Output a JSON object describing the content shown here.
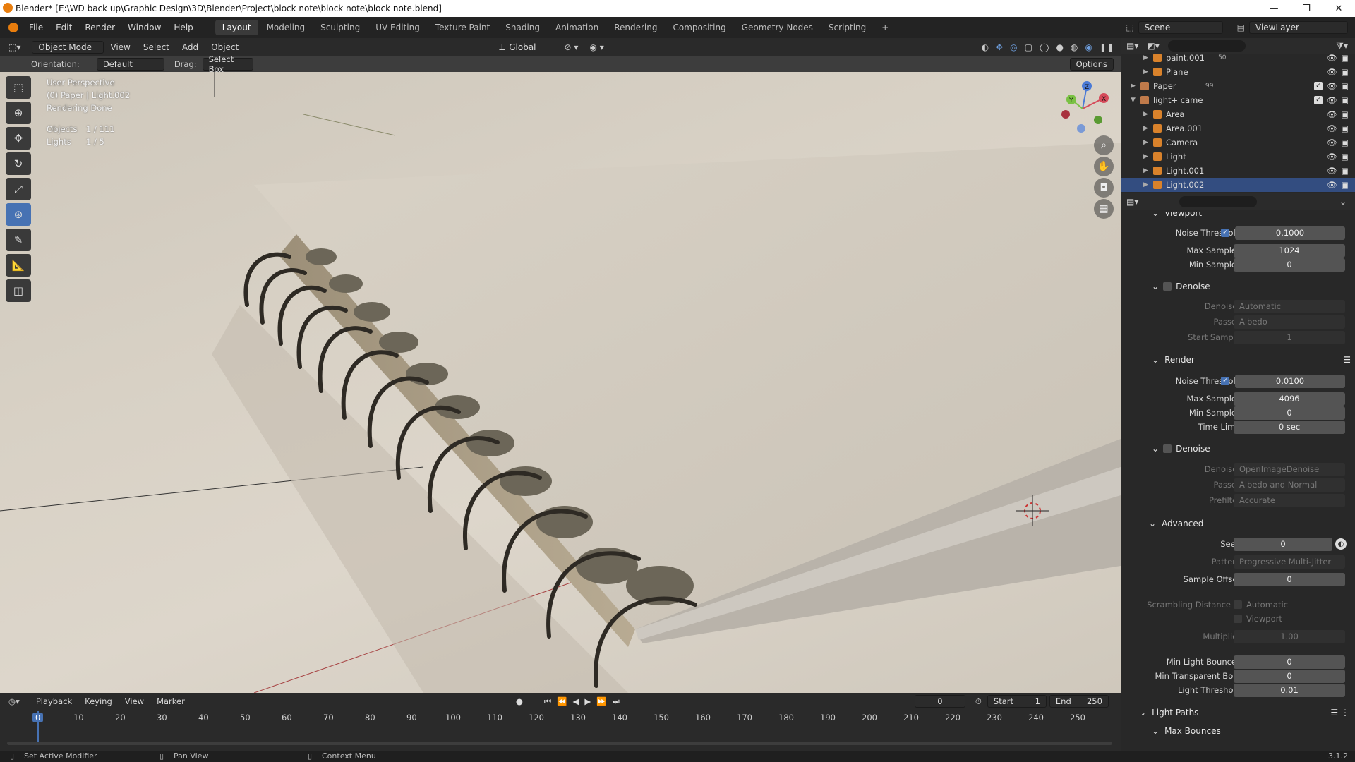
{
  "window": {
    "title": "Blender* [E:\\WD back up\\Graphic Design\\3D\\Blender\\Project\\block note\\block note\\block note.blend]",
    "min": "—",
    "max": "❐",
    "close": "✕"
  },
  "menu": [
    "File",
    "Edit",
    "Render",
    "Window",
    "Help"
  ],
  "workspaces": [
    "Layout",
    "Modeling",
    "Sculpting",
    "UV Editing",
    "Texture Paint",
    "Shading",
    "Animation",
    "Rendering",
    "Compositing",
    "Geometry Nodes",
    "Scripting",
    "+"
  ],
  "active_workspace": "Layout",
  "scene": {
    "label": "Scene",
    "viewlayer": "ViewLayer"
  },
  "header3d": {
    "mode": "Object Mode",
    "menus": [
      "View",
      "Select",
      "Add",
      "Object"
    ],
    "transform": "Global"
  },
  "toolsettings": {
    "orientation_label": "Orientation:",
    "orientation": "Default",
    "drag_label": "Drag:",
    "drag": "Select Box",
    "options": "Options"
  },
  "overlay": {
    "perspective": "User Perspective",
    "object": "(0) Paper | Light.002",
    "status": "Rendering Done",
    "objects_label": "Objects",
    "objects_value": "1 / 111",
    "lights_label": "Lights",
    "lights_value": "1 / 5"
  },
  "gizmo": {
    "x": "X",
    "y": "Y",
    "z": "Z"
  },
  "outliner": [
    {
      "name": "paint.001",
      "sub": "50",
      "indent": 2,
      "sel": false,
      "check": false
    },
    {
      "name": "Plane",
      "sub": "",
      "indent": 2,
      "sel": false,
      "check": false
    },
    {
      "name": "Paper",
      "sub": "99",
      "indent": 1,
      "sel": false,
      "check": true
    },
    {
      "name": "light+ came",
      "sub": "",
      "indent": 1,
      "sel": false,
      "check": true
    },
    {
      "name": "Area",
      "sub": "",
      "indent": 2,
      "sel": false,
      "check": false
    },
    {
      "name": "Area.001",
      "sub": "",
      "indent": 2,
      "sel": false,
      "check": false
    },
    {
      "name": "Camera",
      "sub": "",
      "indent": 2,
      "sel": false,
      "check": false
    },
    {
      "name": "Light",
      "sub": "",
      "indent": 2,
      "sel": false,
      "check": false
    },
    {
      "name": "Light.001",
      "sub": "",
      "indent": 2,
      "sel": false,
      "check": false
    },
    {
      "name": "Light.002",
      "sub": "",
      "indent": 2,
      "sel": true,
      "check": false
    }
  ],
  "props": {
    "viewport": {
      "title": "Viewport",
      "noise_threshold_label": "Noise Threshold",
      "noise_threshold": "0.1000",
      "max_samples_label": "Max Samples",
      "max_samples": "1024",
      "min_samples_label": "Min Samples",
      "min_samples": "0",
      "denoise": "Denoise",
      "denoiser_label": "Denoiser",
      "denoiser": "Automatic",
      "passes_label": "Passes",
      "passes": "Albedo",
      "start_sample_label": "Start Sample",
      "start_sample": "1"
    },
    "render": {
      "title": "Render",
      "noise_threshold_label": "Noise Threshold",
      "noise_threshold": "0.0100",
      "max_samples_label": "Max Samples",
      "max_samples": "4096",
      "min_samples_label": "Min Samples",
      "min_samples": "0",
      "time_limit_label": "Time Limit",
      "time_limit": "0 sec",
      "denoise": "Denoise",
      "denoiser_label": "Denoiser",
      "denoiser": "OpenImageDenoise",
      "passes_label": "Passes",
      "passes": "Albedo and Normal",
      "prefilter_label": "Prefilter",
      "prefilter": "Accurate"
    },
    "advanced": {
      "title": "Advanced",
      "seed_label": "Seed",
      "seed": "0",
      "pattern_label": "Pattern",
      "pattern": "Progressive Multi-Jitter",
      "sample_offset_label": "Sample Offset",
      "sample_offset": "0",
      "scrambling_label": "Scrambling Distance",
      "automatic": "Automatic",
      "viewport": "Viewport",
      "multiplier_label": "Multiplier",
      "multiplier": "1.00",
      "min_light_bounces_label": "Min Light Bounces",
      "min_light_bounces": "0",
      "min_transparent_label": "Min Transparent Bo...",
      "min_transparent": "0",
      "light_threshold_label": "Light Threshold",
      "light_threshold": "0.01"
    },
    "light_paths": "Light Paths",
    "max_bounces": "Max Bounces"
  },
  "timeline": {
    "menus": [
      "Playback",
      "Keying",
      "View",
      "Marker"
    ],
    "current": "0",
    "start_label": "Start",
    "start": "1",
    "end_label": "End",
    "end": "250",
    "ticks": [
      "0",
      "10",
      "20",
      "30",
      "40",
      "50",
      "60",
      "70",
      "80",
      "90",
      "100",
      "110",
      "120",
      "130",
      "140",
      "150",
      "160",
      "170",
      "180",
      "190",
      "200",
      "210",
      "220",
      "230",
      "240",
      "250"
    ]
  },
  "statusbar": {
    "left": "Set Active Modifier",
    "mid": "Pan View",
    "right": "Context Menu",
    "version": "3.1.2"
  }
}
